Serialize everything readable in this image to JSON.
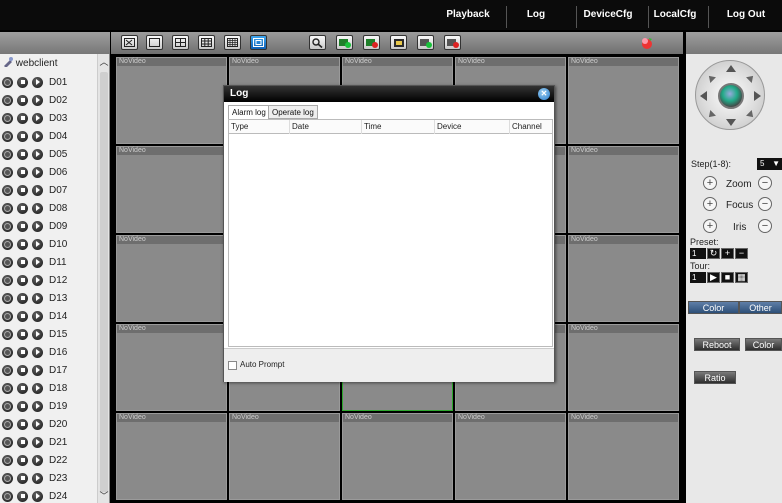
{
  "menu": {
    "items": [
      "Playback",
      "Log",
      "DeviceCfg",
      "LocalCfg",
      "Log Out"
    ]
  },
  "devices": {
    "root": "webclient",
    "items": [
      "D01",
      "D02",
      "D03",
      "D04",
      "D05",
      "D06",
      "D07",
      "D08",
      "D09",
      "D10",
      "D11",
      "D12",
      "D13",
      "D14",
      "D15",
      "D16",
      "D17",
      "D18",
      "D19",
      "D20",
      "D21",
      "D22",
      "D23",
      "D24"
    ]
  },
  "grid": {
    "cell_label": "NoVideo"
  },
  "ptz": {
    "step_label": "Step(1-8):",
    "step_value": "5",
    "zoom_label": "Zoom",
    "focus_label": "Focus",
    "iris_label": "Iris",
    "preset_label": "Preset:",
    "preset_value": "1",
    "tour_label": "Tour:",
    "tour_value": "1",
    "color_tab": "Color",
    "other_tab": "Other",
    "reboot_label": "Reboot",
    "color_label": "Color",
    "ratio_label": "Ratio"
  },
  "log_dialog": {
    "title": "Log",
    "tabs": [
      "Alarm log",
      "Operate log"
    ],
    "columns": [
      "Type",
      "Date",
      "Time",
      "Device",
      "Channel"
    ],
    "auto_prompt": "Auto Prompt"
  },
  "colors": {
    "accent": "#2a7fd0",
    "selected_cell": "#2ea82e"
  }
}
